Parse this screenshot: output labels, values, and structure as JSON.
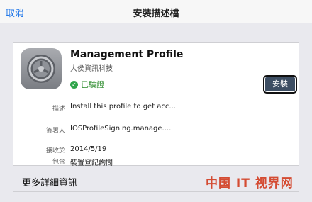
{
  "navbar": {
    "cancel": "取消",
    "title": "安裝描述檔"
  },
  "profile": {
    "icon": "settings-gear-icon",
    "name": "Management Profile",
    "organization": "大侯資訊科技",
    "verified": "已驗證",
    "install_button": "安裝"
  },
  "details": [
    {
      "label": "描述",
      "value": "Install this profile to get acc..."
    },
    {
      "label": "簽署人",
      "value": "IOSProfileSigning.manage...."
    },
    {
      "label": "接收於",
      "value": "2014/5/19"
    },
    {
      "label": "包含",
      "value": "裝置登記詢問"
    }
  ],
  "more_details": "更多詳細資訊",
  "watermark": "中国 IT 视界网",
  "colors": {
    "accent": "#1a73e8",
    "verified": "#2fa44a",
    "install_button": "#3d4e63"
  }
}
